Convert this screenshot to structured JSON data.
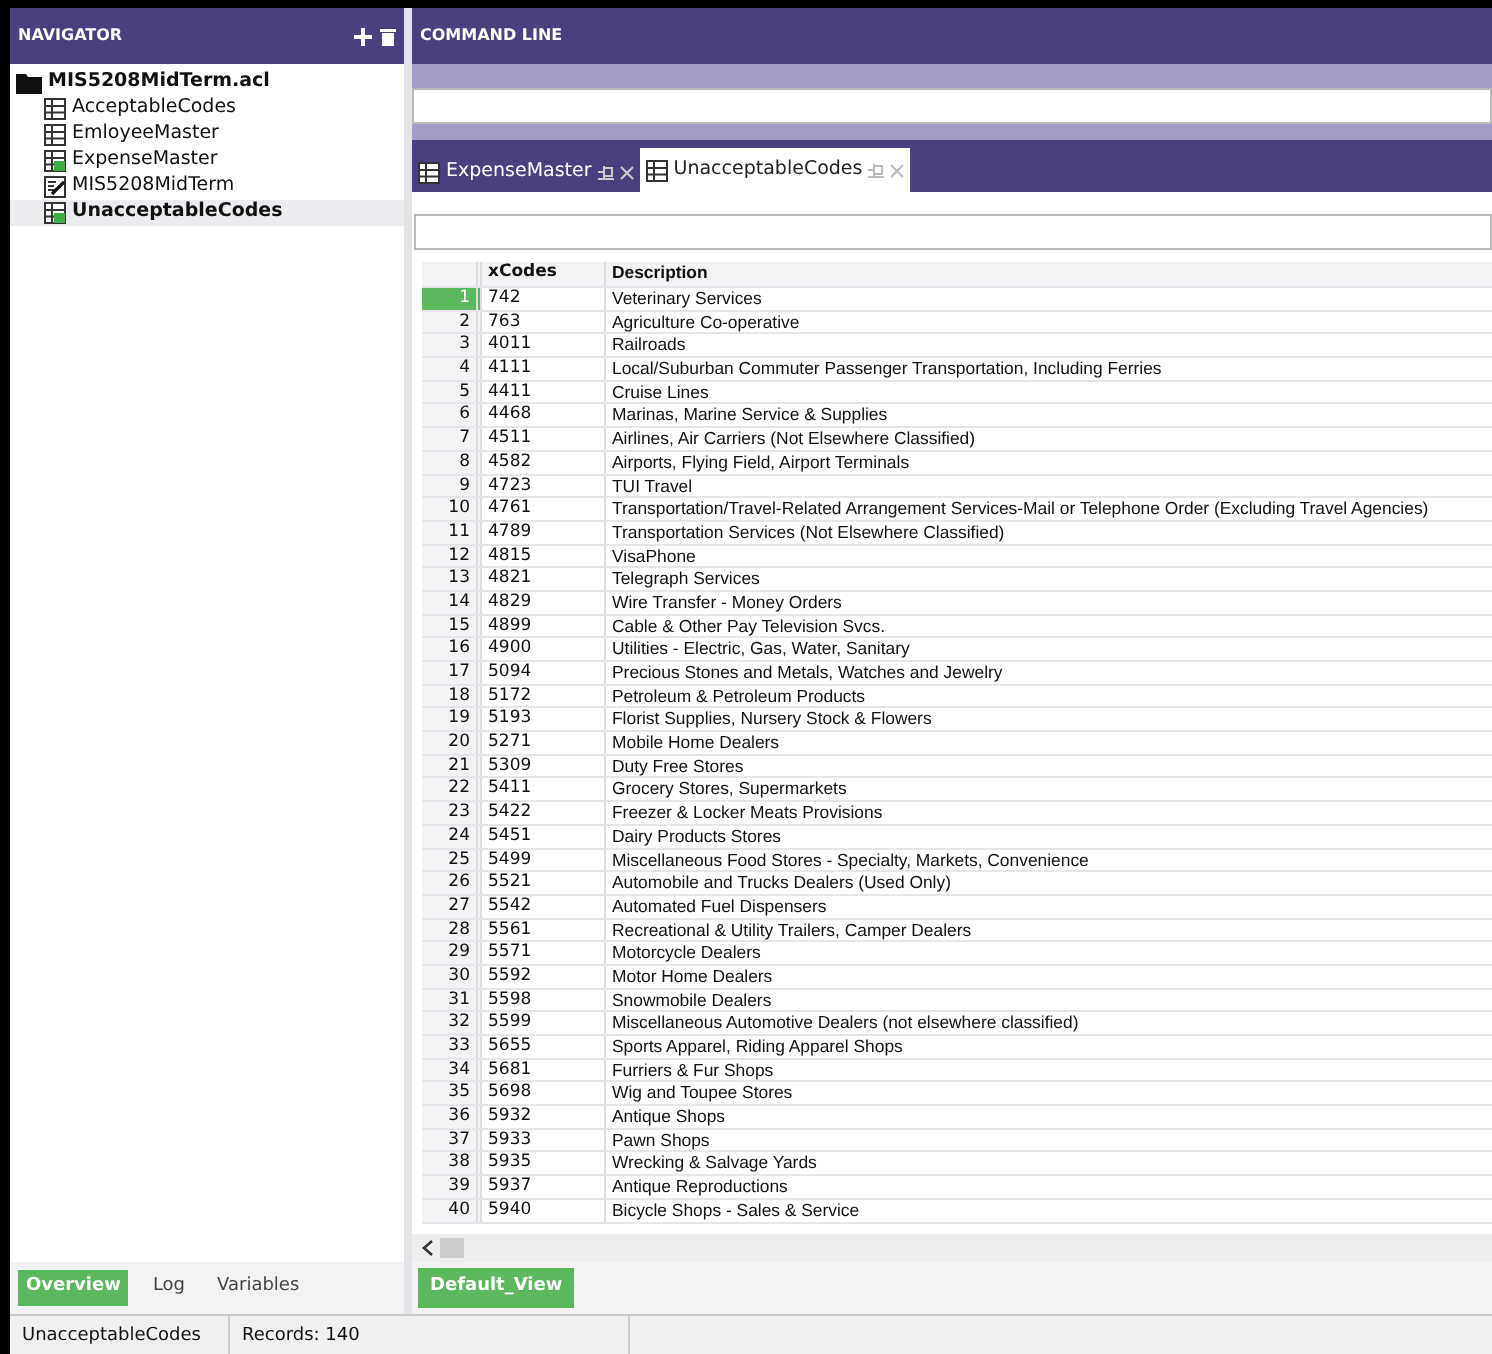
{
  "navigator": {
    "title": "NAVIGATOR",
    "tree": [
      {
        "label": "MIS5208MidTerm.acl",
        "kind": "folder",
        "selected": false,
        "children": [
          {
            "label": "AcceptableCodes",
            "kind": "table",
            "selected": false
          },
          {
            "label": "EmloyeeMaster",
            "kind": "table",
            "selected": false
          },
          {
            "label": "ExpenseMaster",
            "kind": "linked-table",
            "selected": false
          },
          {
            "label": "MIS5208MidTerm",
            "kind": "script",
            "selected": false
          },
          {
            "label": "UnacceptableCodes",
            "kind": "linked-table",
            "selected": true
          }
        ]
      }
    ],
    "bottom_tabs": [
      {
        "label": "Overview",
        "selected": true
      },
      {
        "label": "Log",
        "selected": false
      },
      {
        "label": "Variables",
        "selected": false
      }
    ]
  },
  "command_line": {
    "title": "COMMAND LINE"
  },
  "tabs": [
    {
      "label": "ExpenseMaster",
      "selected": false
    },
    {
      "label": "UnacceptableCodes",
      "selected": true
    }
  ],
  "table": {
    "columns": [
      "xCodes",
      "Description"
    ],
    "rows": [
      {
        "num": "1",
        "code": "742",
        "description": "Veterinary Services",
        "selected": true
      },
      {
        "num": "2",
        "code": "763",
        "description": "Agriculture Co-operative",
        "selected": false
      },
      {
        "num": "3",
        "code": "4011",
        "description": "Railroads",
        "selected": false
      },
      {
        "num": "4",
        "code": "4111",
        "description": "Local/Suburban Commuter Passenger Transportation, Including Ferries",
        "selected": false
      },
      {
        "num": "5",
        "code": "4411",
        "description": "Cruise Lines",
        "selected": false
      },
      {
        "num": "6",
        "code": "4468",
        "description": "Marinas, Marine Service & Supplies",
        "selected": false
      },
      {
        "num": "7",
        "code": "4511",
        "description": "Airlines, Air Carriers (Not Elsewhere Classified)",
        "selected": false
      },
      {
        "num": "8",
        "code": "4582",
        "description": "Airports, Flying Field, Airport Terminals",
        "selected": false
      },
      {
        "num": "9",
        "code": "4723",
        "description": "TUI Travel",
        "selected": false
      },
      {
        "num": "10",
        "code": "4761",
        "description": "Transportation/Travel-Related Arrangement Services-Mail or Telephone Order (Excluding Travel Agencies)",
        "selected": false
      },
      {
        "num": "11",
        "code": "4789",
        "description": "Transportation Services (Not Elsewhere Classified)",
        "selected": false
      },
      {
        "num": "12",
        "code": "4815",
        "description": "VisaPhone",
        "selected": false
      },
      {
        "num": "13",
        "code": "4821",
        "description": "Telegraph Services",
        "selected": false
      },
      {
        "num": "14",
        "code": "4829",
        "description": "Wire Transfer - Money Orders",
        "selected": false
      },
      {
        "num": "15",
        "code": "4899",
        "description": "Cable & Other Pay Television Svcs.",
        "selected": false
      },
      {
        "num": "16",
        "code": "4900",
        "description": "Utilities - Electric, Gas, Water, Sanitary",
        "selected": false
      },
      {
        "num": "17",
        "code": "5094",
        "description": "Precious Stones and Metals, Watches and Jewelry",
        "selected": false
      },
      {
        "num": "18",
        "code": "5172",
        "description": "Petroleum & Petroleum Products",
        "selected": false
      },
      {
        "num": "19",
        "code": "5193",
        "description": "Florist Supplies, Nursery Stock & Flowers",
        "selected": false
      },
      {
        "num": "20",
        "code": "5271",
        "description": "Mobile Home Dealers",
        "selected": false
      },
      {
        "num": "21",
        "code": "5309",
        "description": "Duty Free Stores",
        "selected": false
      },
      {
        "num": "22",
        "code": "5411",
        "description": "Grocery Stores, Supermarkets",
        "selected": false
      },
      {
        "num": "23",
        "code": "5422",
        "description": "Freezer & Locker Meats Provisions",
        "selected": false
      },
      {
        "num": "24",
        "code": "5451",
        "description": "Dairy Products Stores",
        "selected": false
      },
      {
        "num": "25",
        "code": "5499",
        "description": "Miscellaneous Food Stores - Specialty, Markets, Convenience",
        "selected": false
      },
      {
        "num": "26",
        "code": "5521",
        "description": "Automobile and Trucks Dealers (Used Only)",
        "selected": false
      },
      {
        "num": "27",
        "code": "5542",
        "description": "Automated Fuel Dispensers",
        "selected": false
      },
      {
        "num": "28",
        "code": "5561",
        "description": "Recreational & Utility Trailers, Camper Dealers",
        "selected": false
      },
      {
        "num": "29",
        "code": "5571",
        "description": "Motorcycle Dealers",
        "selected": false
      },
      {
        "num": "30",
        "code": "5592",
        "description": "Motor Home Dealers",
        "selected": false
      },
      {
        "num": "31",
        "code": "5598",
        "description": "Snowmobile Dealers",
        "selected": false
      },
      {
        "num": "32",
        "code": "5599",
        "description": "Miscellaneous Automotive Dealers (not elsewhere classified)",
        "selected": false
      },
      {
        "num": "33",
        "code": "5655",
        "description": "Sports Apparel, Riding Apparel Shops",
        "selected": false
      },
      {
        "num": "34",
        "code": "5681",
        "description": "Furriers  & Fur Shops",
        "selected": false
      },
      {
        "num": "35",
        "code": "5698",
        "description": "Wig and Toupee Stores",
        "selected": false
      },
      {
        "num": "36",
        "code": "5932",
        "description": "Antique Shops",
        "selected": false
      },
      {
        "num": "37",
        "code": "5933",
        "description": "Pawn Shops",
        "selected": false
      },
      {
        "num": "38",
        "code": "5935",
        "description": "Wrecking & Salvage Yards",
        "selected": false
      },
      {
        "num": "39",
        "code": "5937",
        "description": "Antique Reproductions",
        "selected": false
      },
      {
        "num": "40",
        "code": "5940",
        "description": "Bicycle Shops - Sales & Service",
        "selected": false
      }
    ]
  },
  "views": [
    {
      "label": "Default_View",
      "selected": true
    }
  ],
  "status_bar": [
    "UnacceptableCodes",
    "Records: 140"
  ]
}
